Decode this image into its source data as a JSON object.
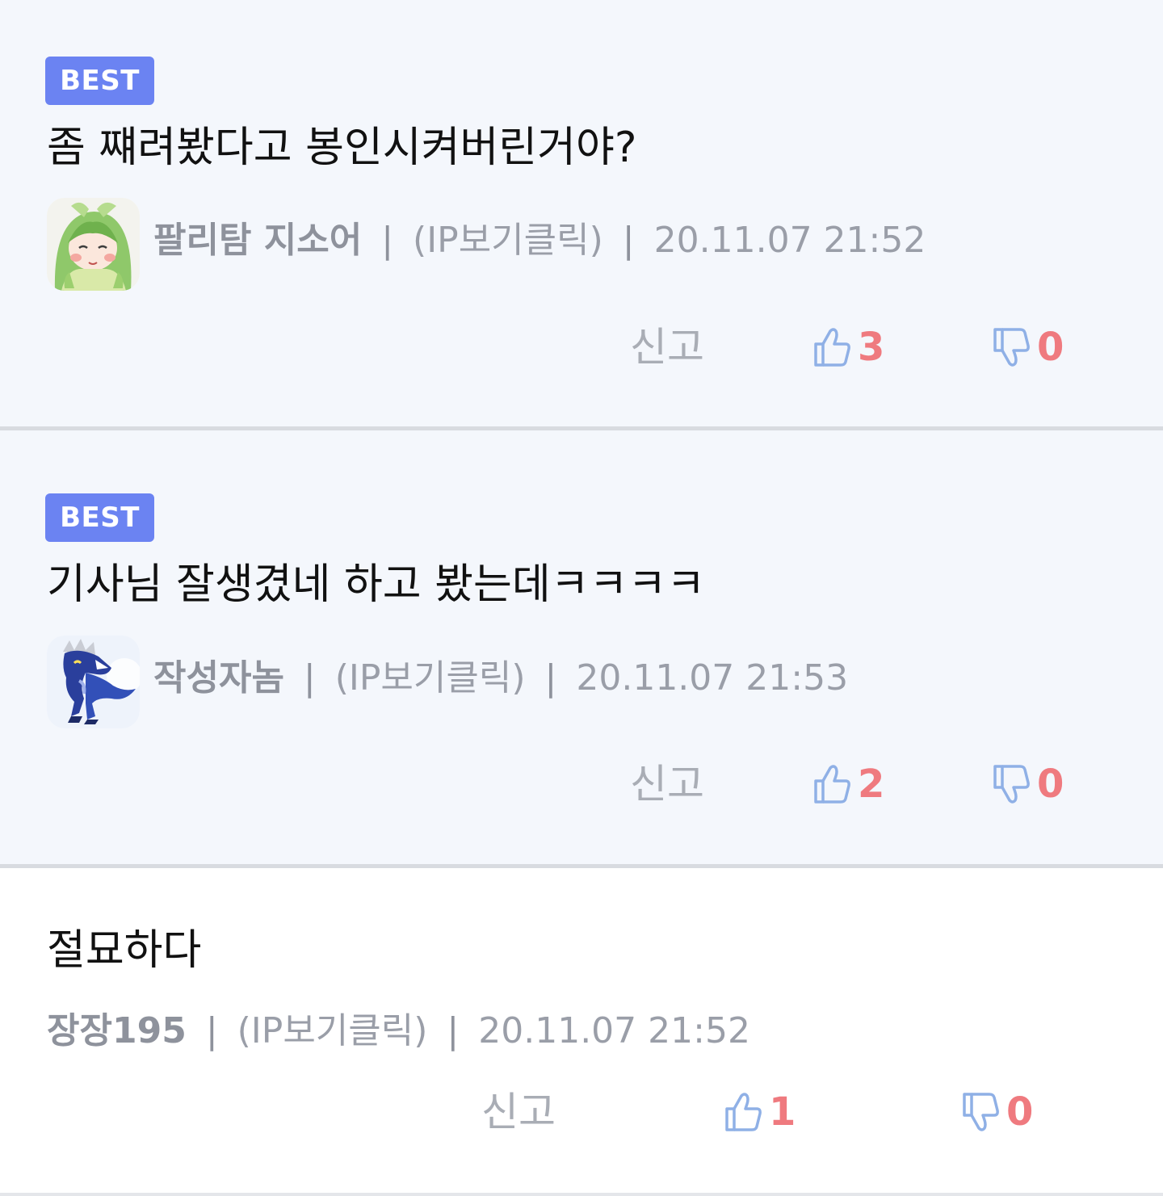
{
  "colors": {
    "best_badge": "#6b83f2",
    "vote_count": "#ef7a7f",
    "thumb_icon": "#8fb0e6",
    "meta_text": "#9a9ea8",
    "best_background": "#f4f7fc"
  },
  "comments": [
    {
      "badge": "BEST",
      "text": "좀 쨰려봤다고 봉인시켜버린거야?",
      "nickname": "팔리탐 지소어",
      "ip": "(IP보기클릭)",
      "timestamp": "20.11.07 21:52",
      "separator": "|",
      "report_label": "신고",
      "likes": "3",
      "dislikes": "0",
      "avatar_icon": "green-haired-anime-girl-avatar"
    },
    {
      "badge": "BEST",
      "text": "기사님 잘생겼네 하고 봤는데ㅋㅋㅋㅋ",
      "nickname": "작성자놈",
      "ip": "(IP보기클릭)",
      "timestamp": "20.11.07 21:53",
      "separator": "|",
      "report_label": "신고",
      "likes": "2",
      "dislikes": "0",
      "avatar_icon": "blue-dinosaur-monster-avatar"
    },
    {
      "text": "절묘하다",
      "nickname": "장장195",
      "ip": "(IP보기클릭)",
      "timestamp": "20.11.07 21:52",
      "separator": "|",
      "report_label": "신고",
      "likes": "1",
      "dislikes": "0"
    }
  ]
}
